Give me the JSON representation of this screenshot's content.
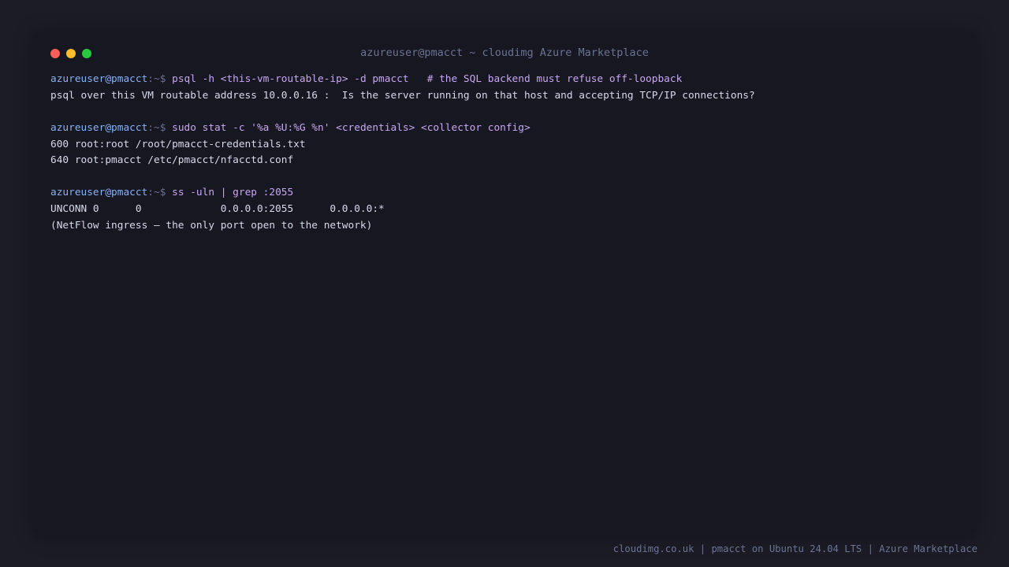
{
  "window": {
    "title": "azureuser@pmacct ~ cloudimg Azure Marketplace",
    "buttons": [
      "close",
      "minimize",
      "maximize"
    ]
  },
  "colors": {
    "background": "#1b1c26",
    "window": "#161721",
    "prompt_user": "#8ab2f2",
    "command": "#c9a7f2",
    "output": "#d6d9ea",
    "muted": "#6c7393",
    "close": "#fe5f57",
    "minimize": "#febc2e",
    "maximize": "#28c840"
  },
  "terminal": {
    "blocks": [
      {
        "prompt_user": "azureuser@pmacct",
        "prompt_sym": ":~$",
        "command": " psql -h <this-vm-routable-ip> -d pmacct   # the SQL backend must refuse off-loopback",
        "output": [
          "psql over this VM routable address 10.0.0.16 :  Is the server running on that host and accepting TCP/IP connections?"
        ]
      },
      {
        "prompt_user": "azureuser@pmacct",
        "prompt_sym": ":~$",
        "command": " sudo stat -c '%a %U:%G %n' <credentials> <collector config>",
        "output": [
          "600 root:root /root/pmacct-credentials.txt",
          "640 root:pmacct /etc/pmacct/nfacctd.conf"
        ]
      },
      {
        "prompt_user": "azureuser@pmacct",
        "prompt_sym": ":~$",
        "command": " ss -uln | grep :2055",
        "output": [
          "UNCONN 0      0             0.0.0.0:2055      0.0.0.0:*",
          "(NetFlow ingress — the only port open to the network)"
        ]
      }
    ]
  },
  "footer": {
    "text": "cloudimg.co.uk | pmacct on Ubuntu 24.04 LTS | Azure Marketplace"
  }
}
